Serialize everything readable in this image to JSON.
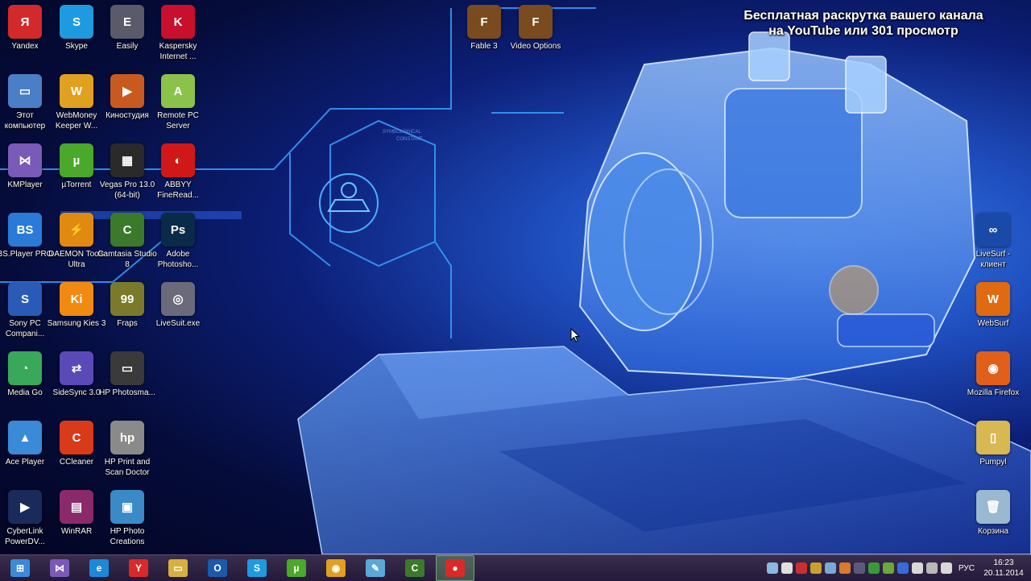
{
  "overlay": {
    "line1": "Бесплатная раскрутка вашего канала",
    "line2": "на YouTube или 301 просмотр"
  },
  "wallpaper": {
    "text1": "SYMBOLOGICAL",
    "text2": "CONSTANT"
  },
  "desktop_icons": {
    "yandex": {
      "label": "Yandex",
      "icon": "yandex-icon",
      "color": "#d22a2a",
      "glyph": "Я"
    },
    "skype": {
      "label": "Skype",
      "icon": "skype-icon",
      "color": "#1e9be0",
      "glyph": "S"
    },
    "easily": {
      "label": "Easily",
      "icon": "easily-icon",
      "color": "#5a5a6a",
      "glyph": "E"
    },
    "kaspersky": {
      "label": "Kaspersky Internet ...",
      "icon": "kaspersky-icon",
      "color": "#c8102e",
      "glyph": "K"
    },
    "fable3": {
      "label": "Fable 3",
      "icon": "fable-icon",
      "color": "#7a4b1e",
      "glyph": "F"
    },
    "video_options": {
      "label": "Video Options",
      "icon": "fable-video-icon",
      "color": "#7a4b1e",
      "glyph": "F"
    },
    "this_pc": {
      "label": "Этот компьютер",
      "icon": "computer-icon",
      "color": "#4a7fc8",
      "glyph": "▭"
    },
    "webmoney": {
      "label": "WebMoney Keeper W...",
      "icon": "webmoney-icon",
      "color": "#e0a020",
      "glyph": "W"
    },
    "kinostudio": {
      "label": "Киностудия",
      "icon": "movie-studio-icon",
      "color": "#c85a20",
      "glyph": "▶"
    },
    "remote_pc": {
      "label": "Remote PC Server",
      "icon": "android-icon",
      "color": "#8bc34a",
      "glyph": "A"
    },
    "kmplayer": {
      "label": "KMPlayer",
      "icon": "kmplayer-icon",
      "color": "#7a5ab8",
      "glyph": "⋈"
    },
    "utorrent": {
      "label": "µTorrent",
      "icon": "utorrent-icon",
      "color": "#4aa82a",
      "glyph": "µ"
    },
    "vegas": {
      "label": "Vegas Pro 13.0 (64-bit)",
      "icon": "vegas-icon",
      "color": "#2a2a2a",
      "glyph": "▦"
    },
    "abbyy": {
      "label": "ABBYY FineRead...",
      "icon": "abbyy-icon",
      "color": "#d01818",
      "glyph": "◐"
    },
    "bsplayer": {
      "label": "BS.Player PRO",
      "icon": "bsplayer-icon",
      "color": "#2a7ad8",
      "glyph": "BS"
    },
    "daemon": {
      "label": "DAEMON Tools Ultra",
      "icon": "daemon-tools-icon",
      "color": "#e08a10",
      "glyph": "⚡"
    },
    "camtasia": {
      "label": "Camtasia Studio 8",
      "icon": "camtasia-icon",
      "color": "#3a7a2a",
      "glyph": "C"
    },
    "photoshop": {
      "label": "Adobe Photosho...",
      "icon": "photoshop-icon",
      "color": "#0a2a4a",
      "glyph": "Ps"
    },
    "sony_pc": {
      "label": "Sony PC Compani...",
      "icon": "sony-pc-icon",
      "color": "#2a5ab8",
      "glyph": "S"
    },
    "samsung_kies": {
      "label": "Samsung Kies 3",
      "icon": "samsung-kies-icon",
      "color": "#f08a10",
      "glyph": "Ki"
    },
    "fraps": {
      "label": "Fraps",
      "icon": "fraps-icon",
      "color": "#7a7a2a",
      "glyph": "99"
    },
    "livesuit_exe": {
      "label": "LiveSuit.exe",
      "icon": "livesuit-exe-icon",
      "color": "#6a6a7a",
      "glyph": "◎"
    },
    "media_go": {
      "label": "Media Go",
      "icon": "media-go-icon",
      "color": "#3aa85a",
      "glyph": "◔"
    },
    "sidesync": {
      "label": "SideSync 3.0",
      "icon": "sidesync-icon",
      "color": "#5a4ab8",
      "glyph": "⇄"
    },
    "hp_photosmart": {
      "label": "HP Photosma...",
      "icon": "printer-icon",
      "color": "#3a3a3a",
      "glyph": "▭"
    },
    "ace_player": {
      "label": "Ace Player",
      "icon": "ace-player-icon",
      "color": "#3a8ad8",
      "glyph": "▲"
    },
    "ccleaner": {
      "label": "CCleaner",
      "icon": "ccleaner-icon",
      "color": "#d83a1a",
      "glyph": "C"
    },
    "hp_print_scan": {
      "label": "HP Print and Scan Doctor",
      "icon": "hp-doctor-icon",
      "color": "#8a8a8a",
      "glyph": "hp"
    },
    "cyberlink": {
      "label": "CyberLink PowerDV...",
      "icon": "powerdvd-icon",
      "color": "#1a2a5a",
      "glyph": "▶"
    },
    "winrar": {
      "label": "WinRAR",
      "icon": "winrar-icon",
      "color": "#8a2a6a",
      "glyph": "▤"
    },
    "hp_photo": {
      "label": "HP Photo Creations",
      "icon": "hp-photo-icon",
      "color": "#3a8ac8",
      "glyph": "▣"
    },
    "livesurf_client": {
      "label": "LiveSurf - клиент",
      "icon": "livesurf-icon",
      "color": "#1a4aa8",
      "glyph": "∞"
    },
    "websurf": {
      "label": "WebSurf",
      "icon": "websurf-icon",
      "color": "#e06a10",
      "glyph": "W"
    },
    "firefox": {
      "label": "Mozilla Firefox",
      "icon": "firefox-icon",
      "color": "#e0601a",
      "glyph": "◉"
    },
    "pumpyl": {
      "label": "Pumpyl",
      "icon": "folder-icon",
      "color": "#d8b850",
      "glyph": "▯"
    },
    "recycle": {
      "label": "Корзина",
      "icon": "recycle-bin-icon",
      "color": "#9ab8d0",
      "glyph": "🗑"
    }
  },
  "taskbar": {
    "buttons": [
      {
        "icon": "start-icon",
        "color": "#3a8ad8",
        "glyph": "⊞"
      },
      {
        "icon": "kmplayer-icon",
        "color": "#7a5ab8",
        "glyph": "⋈"
      },
      {
        "icon": "internet-explorer-icon",
        "color": "#1a8ad8",
        "glyph": "e"
      },
      {
        "icon": "yandex-browser-icon",
        "color": "#d82a2a",
        "glyph": "Y"
      },
      {
        "icon": "explorer-icon",
        "color": "#d8b040",
        "glyph": "▭"
      },
      {
        "icon": "outlook-icon",
        "color": "#1a5aa8",
        "glyph": "O"
      },
      {
        "icon": "skype-icon",
        "color": "#1e9be0",
        "glyph": "S"
      },
      {
        "icon": "utorrent-icon",
        "color": "#4aa82a",
        "glyph": "µ"
      },
      {
        "icon": "chrome-icon",
        "color": "#e0a020",
        "glyph": "◉"
      },
      {
        "icon": "notepad-icon",
        "color": "#5aa8d8",
        "glyph": "✎"
      },
      {
        "icon": "camtasia-icon",
        "color": "#3a7a2a",
        "glyph": "C"
      },
      {
        "icon": "camtasia-recorder-icon",
        "color": "#d82a2a",
        "glyph": "●"
      }
    ],
    "language": "РУС",
    "time": "16:23",
    "date": "20.11.2014"
  }
}
